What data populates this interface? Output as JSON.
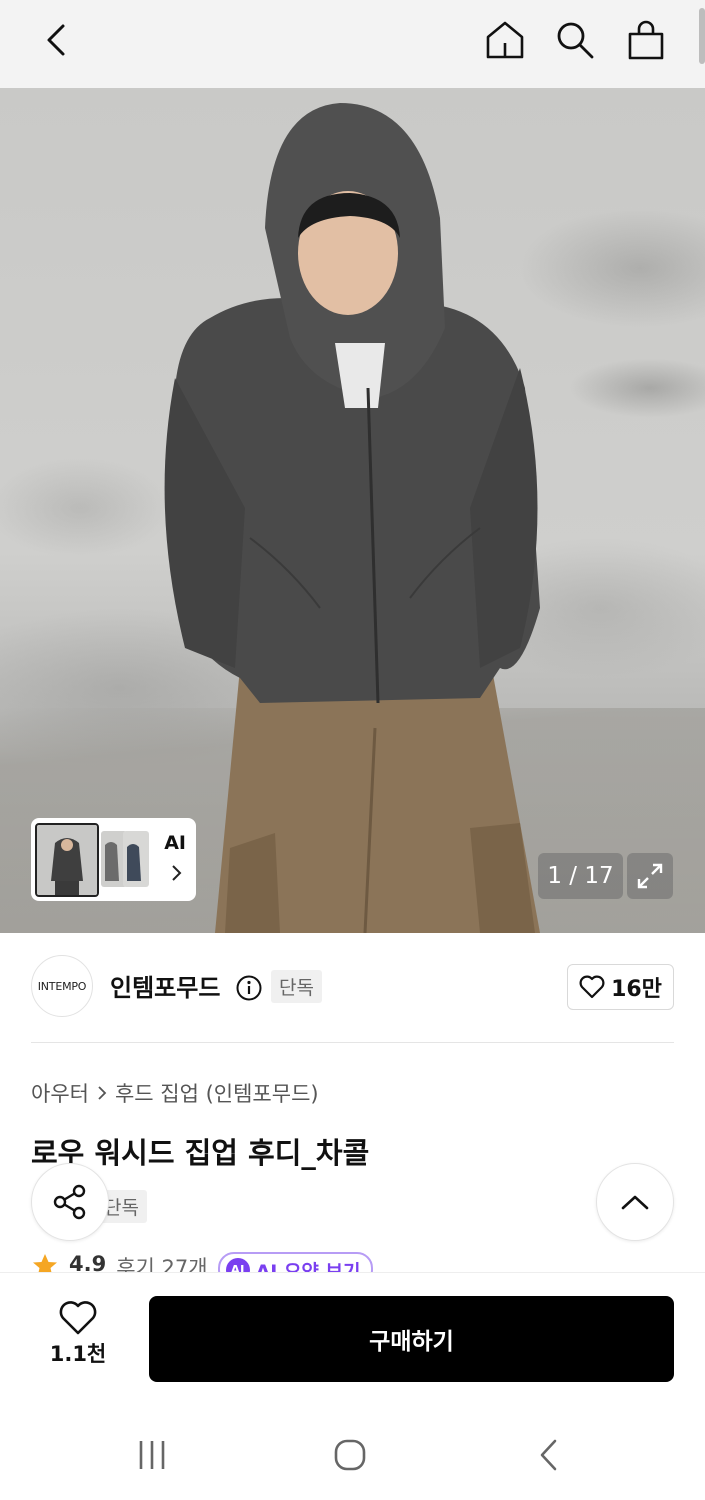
{
  "header": {
    "icons": [
      "back-icon",
      "home-icon",
      "search-icon",
      "shopping-bag-icon"
    ]
  },
  "gallery": {
    "ai_label": "AI",
    "counter": "1 / 17"
  },
  "brand": {
    "logo_text": "INTEMPO",
    "name": "인템포무드",
    "badge": "단독",
    "likes": "16만"
  },
  "product": {
    "breadcrumb": [
      "아우터",
      "후드 집업 (인템포무드)"
    ],
    "title": "로우 워시드 집업 후디_차콜",
    "badge": "단독",
    "rating": "4.9",
    "reviews": "후기 27개",
    "ai_summary_label": "AI 요약 보기"
  },
  "purchase": {
    "wish_count": "1.1천",
    "buy_label": "구매하기"
  },
  "colors": {
    "buy_button": "#000000",
    "ai_accent": "#7a3ff0",
    "star": "#f5a623"
  }
}
